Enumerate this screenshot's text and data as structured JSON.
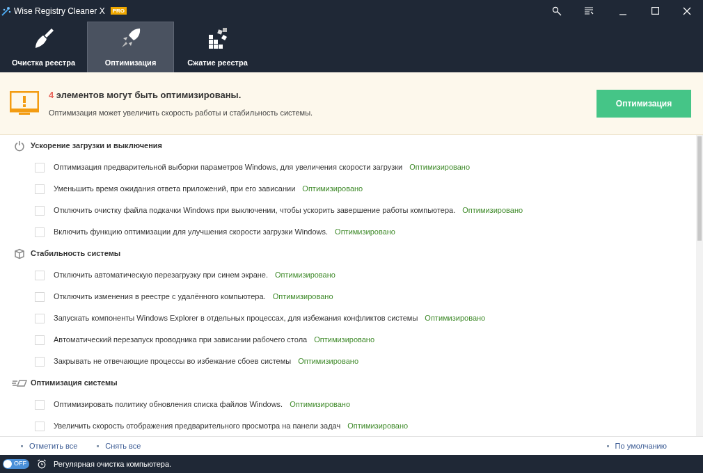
{
  "window": {
    "title": "Wise Registry Cleaner X",
    "badge": "PRO"
  },
  "tabs": [
    {
      "label": "Очистка реестра",
      "kind": "broom",
      "selected": false
    },
    {
      "label": "Оптимизация",
      "kind": "rocket",
      "selected": true
    },
    {
      "label": "Сжатие реестра",
      "kind": "blocks",
      "selected": false
    }
  ],
  "banner": {
    "count": "4",
    "headline": " элементов могут быть оптимизированы.",
    "text": "Оптимизация может увеличить скорость работы и стабильность системы.",
    "button": "Оптимизация"
  },
  "sections": [
    {
      "title": "Ускорение загрузки и выключения",
      "kind": "power",
      "items": [
        {
          "label": "Оптимизация предварительной выборки параметров Windows, для увеличения скорости загрузки",
          "status": "Оптимизировано",
          "checked": false
        },
        {
          "label": "Уменьшить время ожидания ответа приложений, при его зависании",
          "status": "Оптимизировано",
          "checked": false
        },
        {
          "label": "Отключить очистку файла подкачки Windows при выключении, чтобы ускорить завершение работы компьютера.",
          "status": "Оптимизировано",
          "checked": false
        },
        {
          "label": "Включить функцию оптимизации для улучшения скорости загрузки Windows.",
          "status": "Оптимизировано",
          "checked": false
        }
      ]
    },
    {
      "title": "Стабильность системы",
      "kind": "box",
      "items": [
        {
          "label": "Отключить автоматическую перезагрузку при синем экране.",
          "status": "Оптимизировано",
          "checked": false
        },
        {
          "label": "Отключить изменения в реестре с удалённого компьютера.",
          "status": "Оптимизировано",
          "checked": false
        },
        {
          "label": "Запускать компоненты Windows Explorer в отдельных процессах, для избежания конфликтов системы",
          "status": "Оптимизировано",
          "checked": false
        },
        {
          "label": "Автоматический перезапуск проводника при зависании рабочего стола",
          "status": "Оптимизировано",
          "checked": false
        },
        {
          "label": "Закрывать не отвечающие процессы во избежание сбоев системы",
          "status": "Оптимизировано",
          "checked": false
        }
      ]
    },
    {
      "title": "Оптимизация системы",
      "kind": "display",
      "items": [
        {
          "label": "Оптимизировать политику обновления списка файлов Windows.",
          "status": "Оптимизировано",
          "checked": false
        },
        {
          "label": "Увеличить скорость отображения предварительного просмотра на панели задач",
          "status": "Оптимизировано",
          "checked": false
        }
      ]
    }
  ],
  "footer_links": [
    {
      "label": "Отметить все"
    },
    {
      "label": "Снять все"
    },
    {
      "label": "По умолчанию"
    }
  ],
  "status_bar": {
    "toggle": "OFF",
    "on": false,
    "text": "Регулярная очистка компьютера."
  }
}
